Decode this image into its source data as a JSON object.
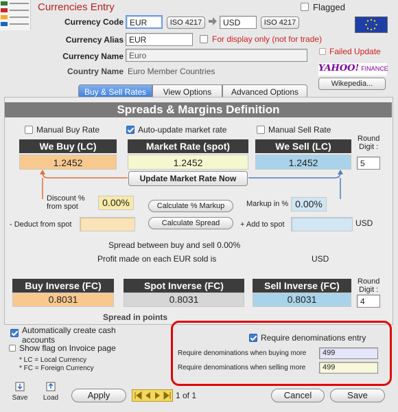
{
  "window": {
    "title": "Currencies Entry",
    "flagged_label": "Flagged"
  },
  "currency": {
    "code_label": "Currency Code",
    "code_value": "EUR",
    "iso_left": "ISO 4217",
    "target_code": "USD",
    "iso_right": "ISO 4217",
    "alias_label": "Currency Alias",
    "alias_value": "EUR",
    "display_only_label": "For display only (not for trade)",
    "name_label": "Currency Name",
    "name_value": "Euro",
    "failed_update_label": "Failed Update",
    "country_label": "Country Name",
    "country_value": "Euro Member Countries",
    "yahoo_logo": "YAHOO!",
    "yahoo_suffix": "FINANCE",
    "wikipedia_button": "Wikepedia..."
  },
  "tabs": [
    {
      "label": "Buy & Sell Rates",
      "selected": true
    },
    {
      "label": "View Options",
      "selected": false
    },
    {
      "label": "Advanced Options",
      "selected": false
    }
  ],
  "section": {
    "title": "Spreads & Margins Definition",
    "manual_buy_label": "Manual Buy Rate",
    "auto_update_label": "Auto-update market rate",
    "manual_sell_label": "Manual Sell Rate",
    "round_digit_label1": "Round",
    "round_digit_label2": "Digit :",
    "we_buy_header": "We Buy (LC)",
    "market_rate_header": "Market Rate (spot)",
    "we_sell_header": "We Sell (LC)",
    "we_buy_value": "1.2452",
    "market_rate_value": "1.2452",
    "we_sell_value": "1.2452",
    "round_digit_value": "5",
    "update_button": "Update Market Rate Now",
    "discount_label1": "Discount %",
    "discount_label2": "from spot",
    "discount_value": "0.00%",
    "calc_markup_button": "Calculate % Markup",
    "markup_label": "Markup in %",
    "markup_value": "0.00%",
    "deduct_label": "- Deduct from spot",
    "calc_spread_button": "Calculate Spread",
    "add_label": "+ Add to spot",
    "usd_label": "USD",
    "spread_text": "Spread between buy and sell 0.00%",
    "profit_text": "Profit made on each EUR sold is",
    "profit_currency": "USD",
    "buy_inverse_header": "Buy Inverse (FC)",
    "spot_inverse_header": "Spot Inverse (FC)",
    "sell_inverse_header": "Sell Inverse (FC)",
    "buy_inverse_value": "0.8031",
    "spot_inverse_value": "0.8031",
    "sell_inverse_value": "0.8031",
    "round_inverse_value": "4",
    "spread_points_label": "Spread in points"
  },
  "bottom": {
    "auto_create_label1": "Automatically create cash",
    "auto_create_label2": "accounts",
    "show_flag_label": "Show flag on Invoice page",
    "lc_note": "* LC = Local Currency",
    "fc_note": "* FC = Foreign Currency",
    "require_denoms_label": "Require denominations entry",
    "require_buying_label": "Require denominations when buying more",
    "require_buying_value": "499",
    "require_selling_label": "Require denominations when selling more",
    "require_selling_value": "499"
  },
  "toolbar": {
    "save_icon_label": "Save",
    "load_icon_label": "Load",
    "apply_button": "Apply",
    "record_counter": "1 of 1",
    "cancel_button": "Cancel",
    "save_button": "Save"
  },
  "colors": {
    "title_red": "#b22222",
    "buy_orange": "#f8c98f",
    "market_yellow": "#f5f8cf",
    "sell_blue": "#a9d3ea",
    "header_dark": "#3c3c3c",
    "highlight_red": "#e00000"
  }
}
